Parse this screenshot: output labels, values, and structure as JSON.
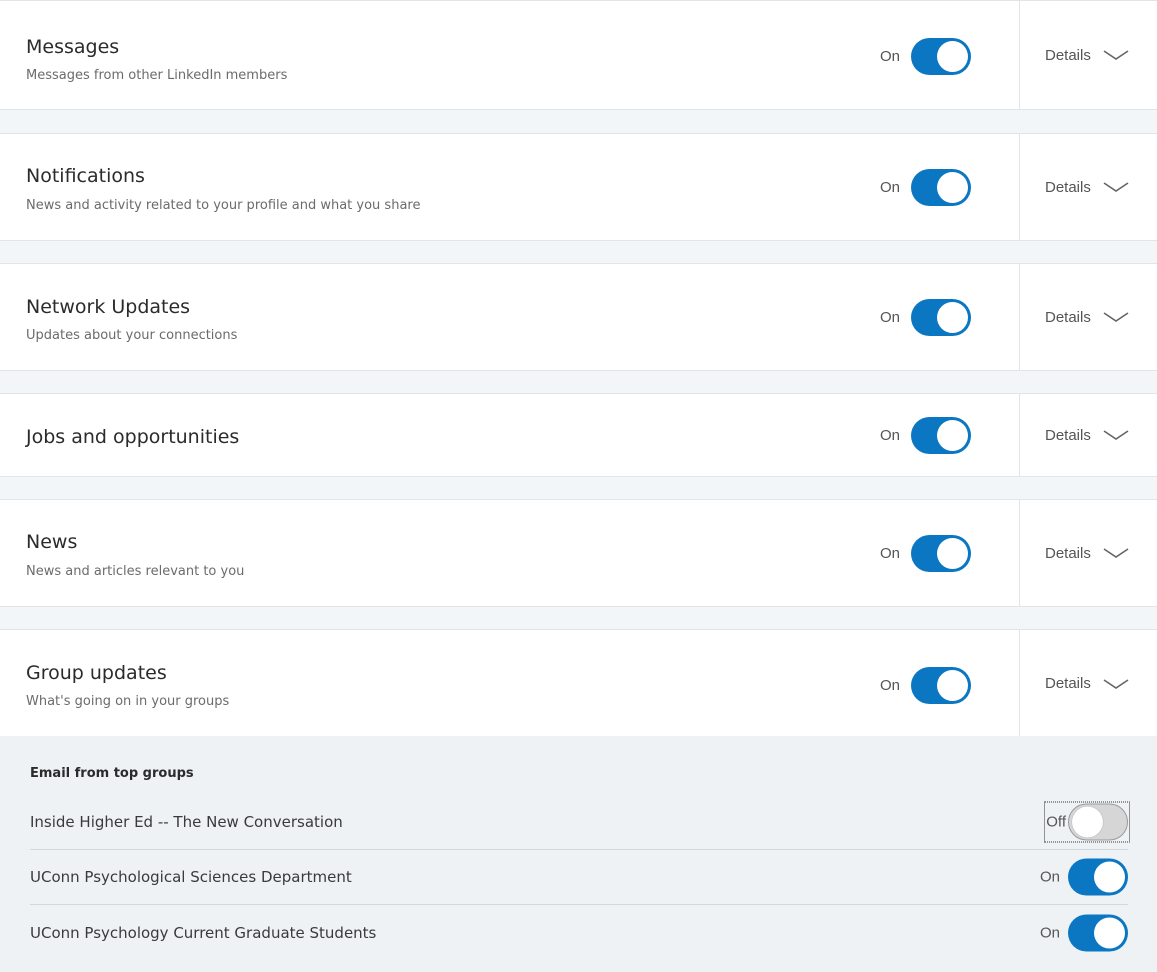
{
  "sections": [
    {
      "key": "messages",
      "title": "Messages",
      "subtitle": "Messages from other LinkedIn members",
      "toggle": "On",
      "details": "Details"
    },
    {
      "key": "notifications",
      "title": "Notifications",
      "subtitle": "News and activity related to your profile and what you share",
      "toggle": "On",
      "details": "Details"
    },
    {
      "key": "network-updates",
      "title": "Network Updates",
      "subtitle": "Updates about your connections",
      "toggle": "On",
      "details": "Details"
    },
    {
      "key": "jobs",
      "title": "Jobs and opportunities",
      "subtitle": "",
      "toggle": "On",
      "details": "Details"
    },
    {
      "key": "news",
      "title": "News",
      "subtitle": "News and articles relevant to you",
      "toggle": "On",
      "details": "Details"
    },
    {
      "key": "group-updates",
      "title": "Group updates",
      "subtitle": "What's going on in your groups",
      "toggle": "On",
      "details": "Details"
    }
  ],
  "groups_panel": {
    "heading": "Email from top groups",
    "groups": [
      {
        "name": "Inside Higher Ed -- The New Conversation",
        "toggle": "Off"
      },
      {
        "name": "UConn Psychological Sciences Department",
        "toggle": "On"
      },
      {
        "name": "UConn Psychology Current Graduate Students",
        "toggle": "On"
      }
    ]
  },
  "colors": {
    "toggle_on": "#0b77c2",
    "toggle_off": "#d6d6d6",
    "panel_bg": "#eef2f5"
  }
}
